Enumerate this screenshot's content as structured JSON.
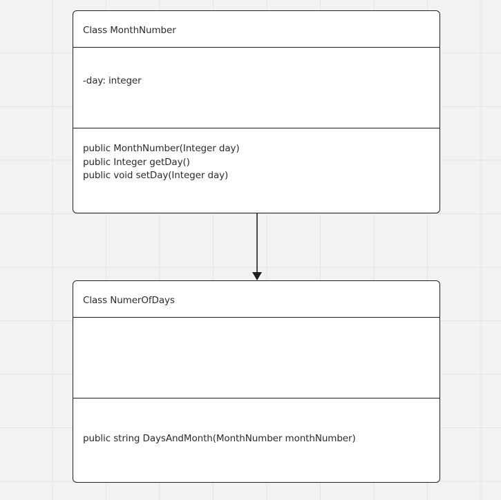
{
  "diagram": {
    "classes": [
      {
        "name": "Class MonthNumber",
        "attributes": [
          "-day: integer"
        ],
        "operations": [
          "public MonthNumber(Integer day)",
          "public Integer getDay()",
          "public void setDay(Integer day)"
        ]
      },
      {
        "name": "Class NumerOfDays",
        "attributes": [],
        "operations": [
          "public string DaysAndMonth(MonthNumber monthNumber)"
        ]
      }
    ],
    "relationships": [
      {
        "from": "Class MonthNumber",
        "to": "Class NumerOfDays",
        "type": "directed-association"
      }
    ]
  },
  "colors": {
    "canvas": "#f2f2f2",
    "grid": "#e4e4e4",
    "box_fill": "#ffffff",
    "stroke": "#1e1e1e",
    "text": "#2b2b2b"
  }
}
